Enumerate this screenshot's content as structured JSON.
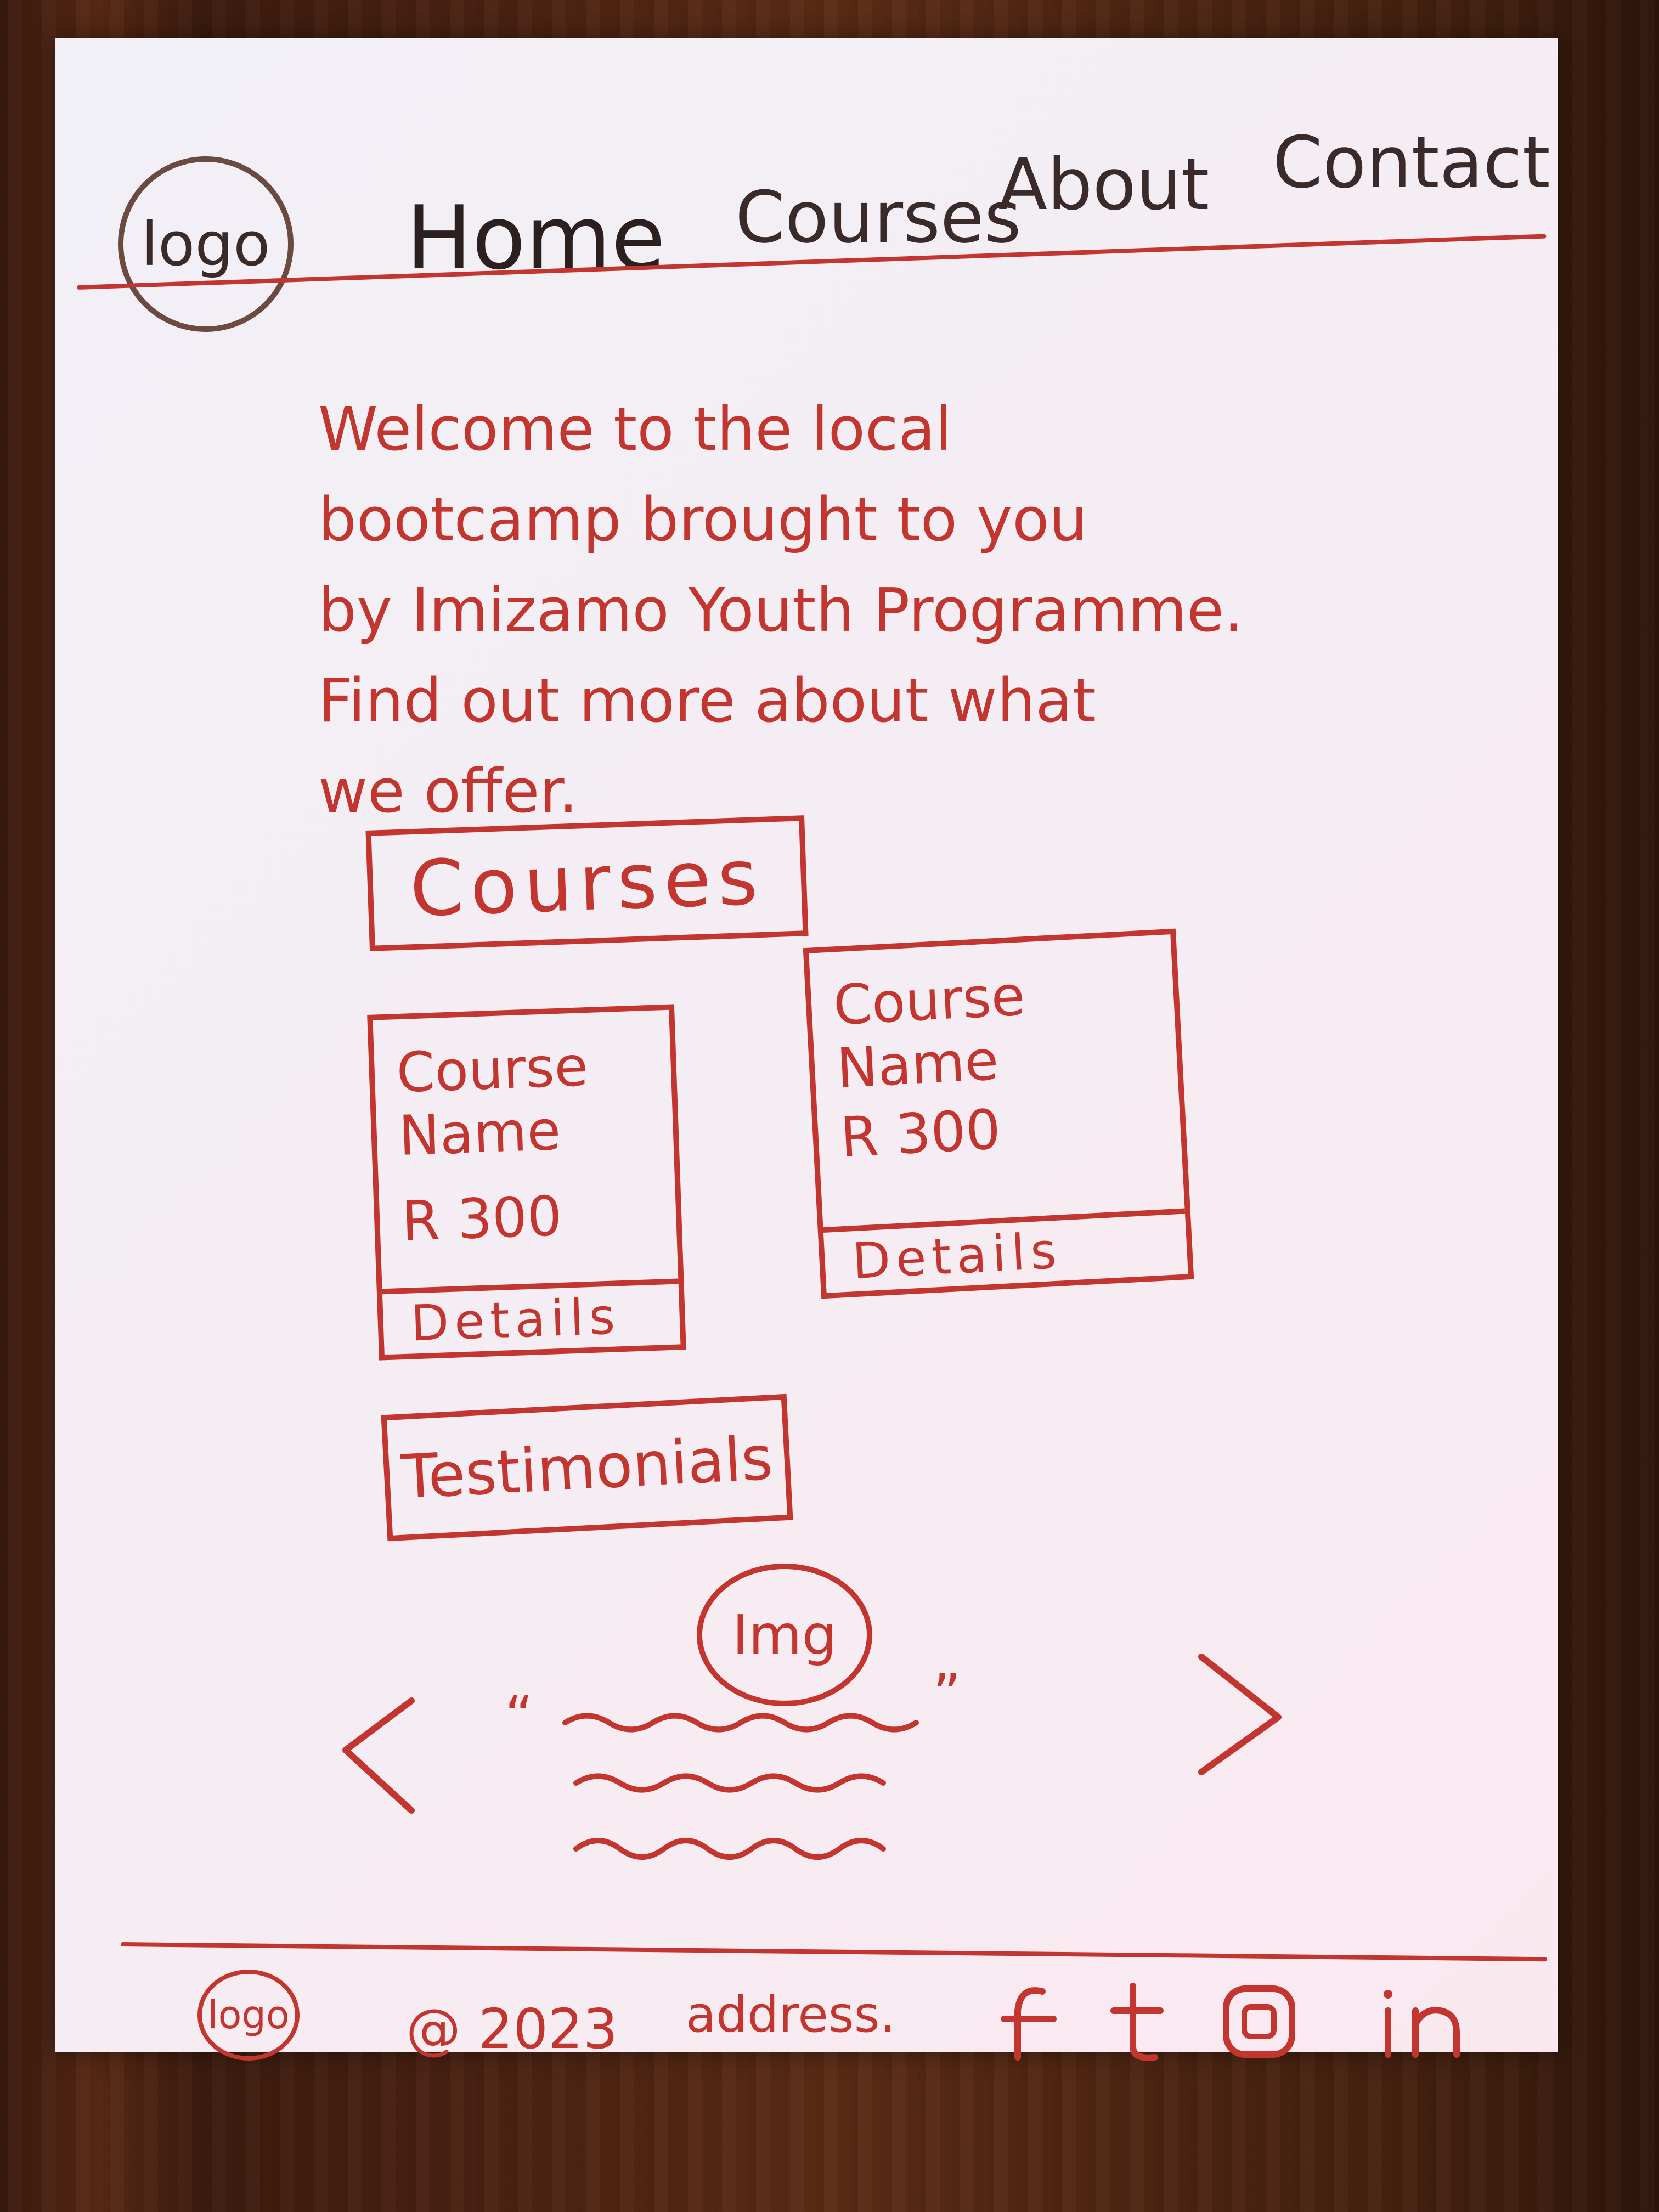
{
  "header": {
    "logo_label": "logo",
    "nav": {
      "home": "Home",
      "courses": "Courses",
      "about": "About",
      "contact": "Contact"
    }
  },
  "hero": {
    "text": "Welcome to the local\nbootcamp brought to you\nby Imizamo Youth Programme.\nFind out more about what\nwe offer."
  },
  "courses": {
    "heading": "Courses",
    "cards": [
      {
        "name": "Course\nName",
        "price": "R 300",
        "details": "Details"
      },
      {
        "name": "Course\nName",
        "price": "R 300",
        "details": "Details"
      }
    ]
  },
  "testimonials": {
    "heading": "Testimonials",
    "image_label": "Img",
    "open_quote": "“",
    "close_quote": "”",
    "prev_icon": "chevron-left-icon",
    "next_icon": "chevron-right-icon"
  },
  "footer": {
    "logo_label": "logo",
    "copyright": "@ 2023",
    "address": "address.",
    "social_icons": [
      "facebook-icon",
      "tumblr-icon",
      "instagram-icon",
      "linkedin-icon"
    ]
  },
  "colors": {
    "ink": "#c2362f",
    "paper": "#f4eef4"
  }
}
